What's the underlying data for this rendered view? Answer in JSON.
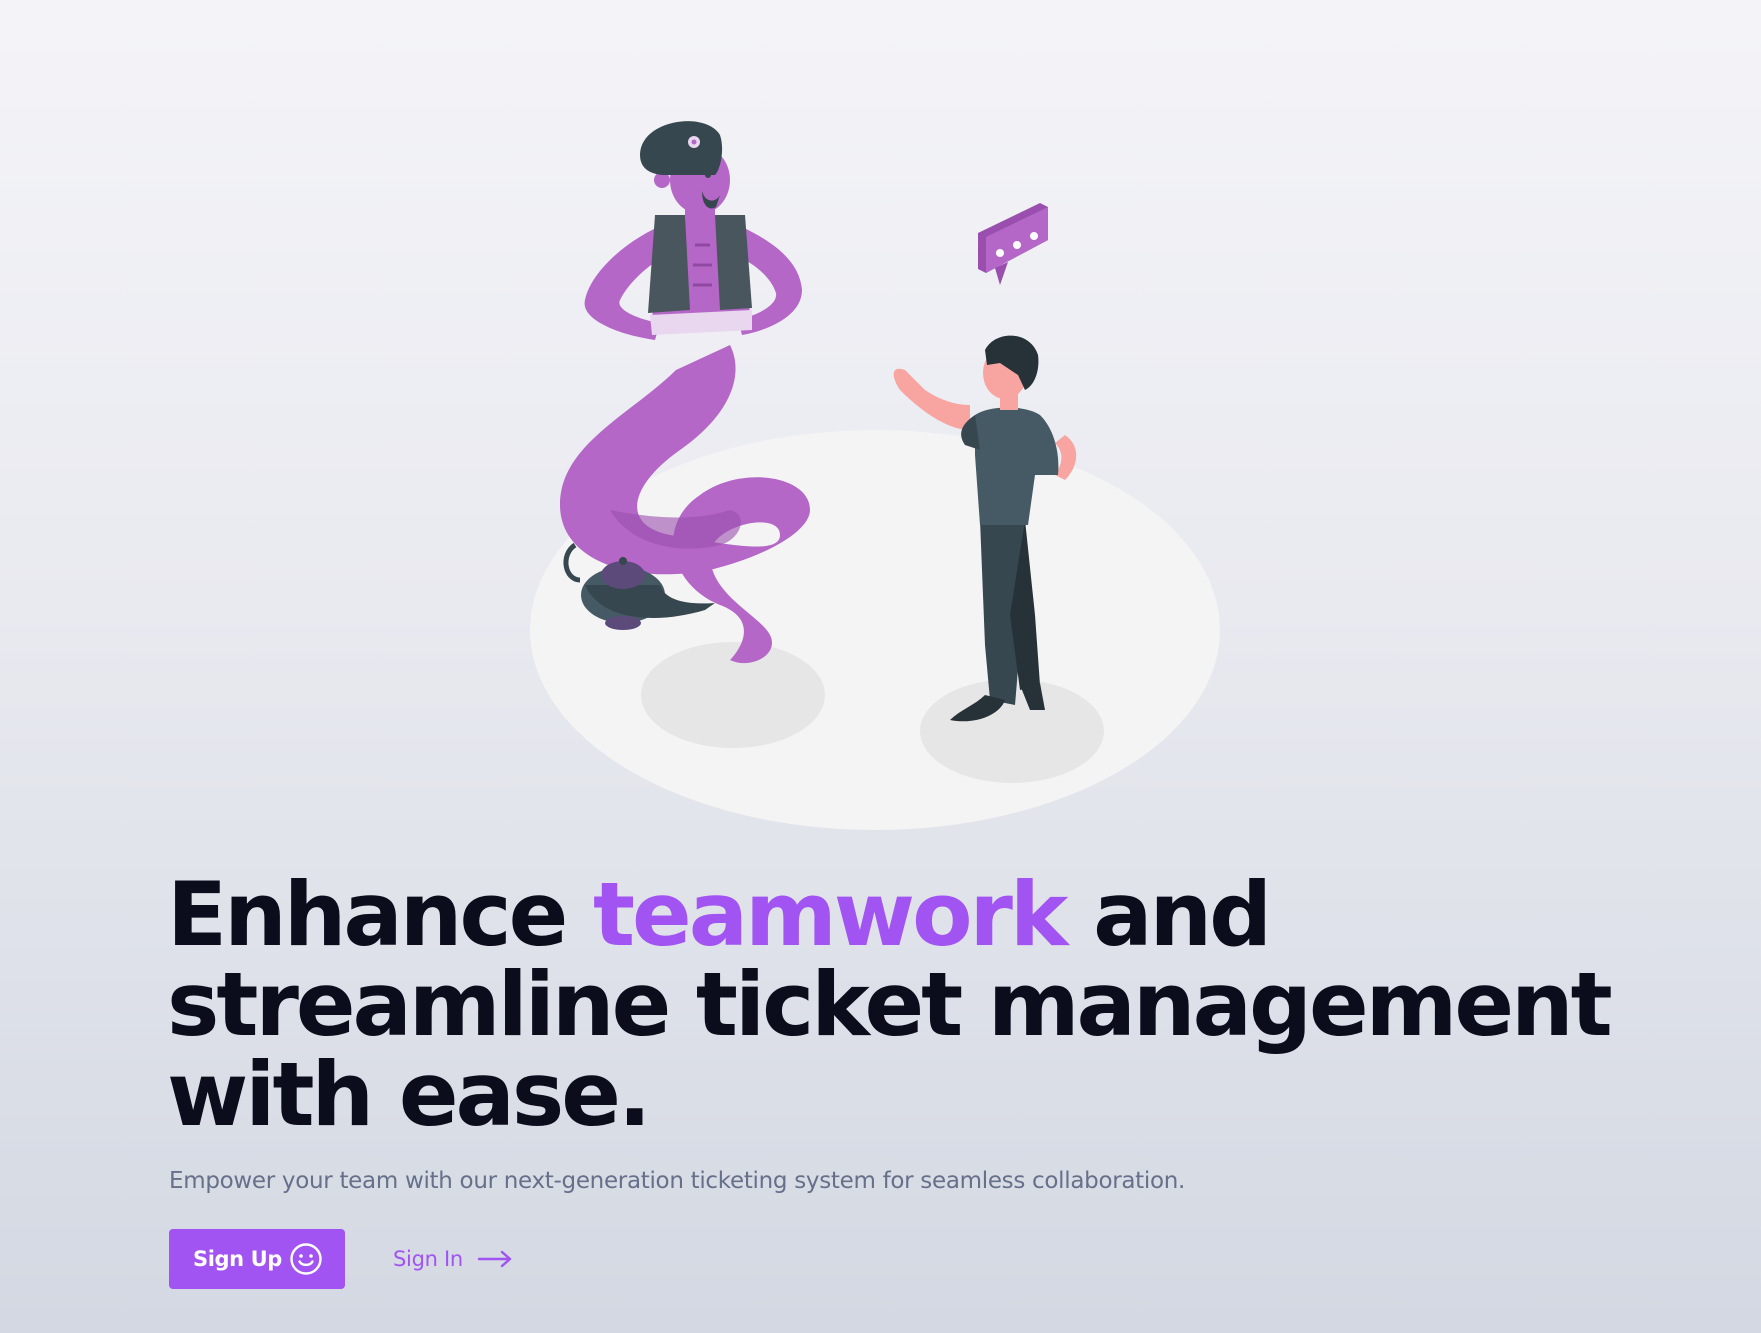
{
  "hero": {
    "headline_before": "Enhance ",
    "headline_accent": "teamwork",
    "headline_line1_after": " and",
    "headline_line2": "streamline ticket management",
    "headline_line3": "with ease.",
    "subtitle": "Empower your team with our next-generation ticketing system for seamless collaboration."
  },
  "actions": {
    "signup_label": "Sign Up",
    "signup_icon": "smiley-icon",
    "signin_label": "Sign In",
    "signin_icon": "arrow-right-icon"
  },
  "illustration": {
    "subject": "genie-lamp-person-chat-illustration"
  },
  "colors": {
    "accent": "#a254f2",
    "headline": "#0c0d1c",
    "subtitle": "#67708a"
  }
}
